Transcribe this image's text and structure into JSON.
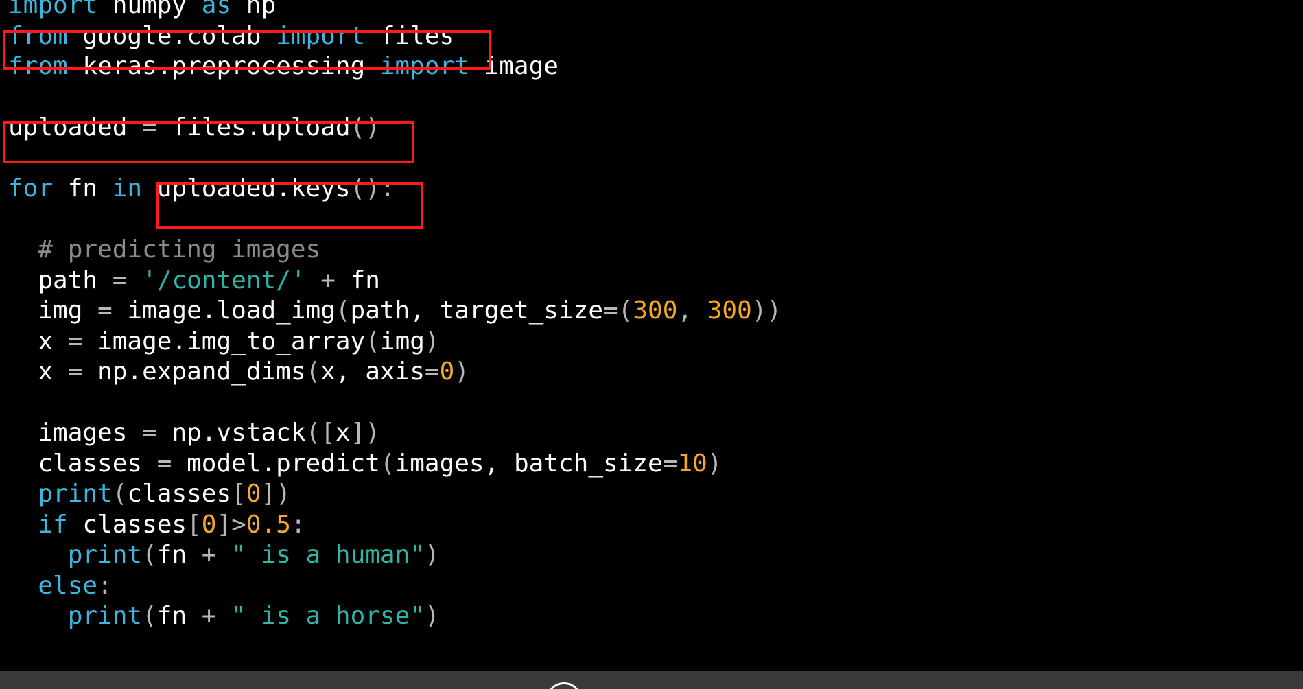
{
  "code": {
    "lines": [
      [
        {
          "t": "import",
          "c": "kw"
        },
        {
          "t": " numpy ",
          "c": ""
        },
        {
          "t": "as",
          "c": "kw"
        },
        {
          "t": " np",
          "c": ""
        }
      ],
      [
        {
          "t": "from",
          "c": "kw"
        },
        {
          "t": " google.colab ",
          "c": ""
        },
        {
          "t": "import",
          "c": "kw"
        },
        {
          "t": " files",
          "c": ""
        }
      ],
      [
        {
          "t": "from",
          "c": "kw"
        },
        {
          "t": " keras.preprocessing ",
          "c": ""
        },
        {
          "t": "import",
          "c": "kw"
        },
        {
          "t": " image",
          "c": ""
        }
      ],
      [],
      [
        {
          "t": "uploaded ",
          "c": ""
        },
        {
          "t": "=",
          "c": "op"
        },
        {
          "t": " files.upload",
          "c": ""
        },
        {
          "t": "()",
          "c": "op"
        }
      ],
      [],
      [
        {
          "t": "for",
          "c": "kw"
        },
        {
          "t": " fn ",
          "c": ""
        },
        {
          "t": "in",
          "c": "kw"
        },
        {
          "t": " uploaded.keys",
          "c": ""
        },
        {
          "t": "():",
          "c": "op"
        }
      ],
      [],
      [
        {
          "t": "  ",
          "c": ""
        },
        {
          "t": "# predicting images",
          "c": "cmt"
        }
      ],
      [
        {
          "t": "  path ",
          "c": ""
        },
        {
          "t": "=",
          "c": "op"
        },
        {
          "t": " ",
          "c": ""
        },
        {
          "t": "'/content/'",
          "c": "str"
        },
        {
          "t": " ",
          "c": ""
        },
        {
          "t": "+",
          "c": "op"
        },
        {
          "t": " fn",
          "c": ""
        }
      ],
      [
        {
          "t": "  img ",
          "c": ""
        },
        {
          "t": "=",
          "c": "op"
        },
        {
          "t": " image.load_img",
          "c": ""
        },
        {
          "t": "(",
          "c": "op"
        },
        {
          "t": "path, target_size",
          "c": ""
        },
        {
          "t": "=(",
          "c": "op"
        },
        {
          "t": "300",
          "c": "num"
        },
        {
          "t": ", ",
          "c": "op"
        },
        {
          "t": "300",
          "c": "num"
        },
        {
          "t": "))",
          "c": "op"
        }
      ],
      [
        {
          "t": "  x ",
          "c": ""
        },
        {
          "t": "=",
          "c": "op"
        },
        {
          "t": " image.img_to_array",
          "c": ""
        },
        {
          "t": "(",
          "c": "op"
        },
        {
          "t": "img",
          "c": ""
        },
        {
          "t": ")",
          "c": "op"
        }
      ],
      [
        {
          "t": "  x ",
          "c": ""
        },
        {
          "t": "=",
          "c": "op"
        },
        {
          "t": " np.expand_dims",
          "c": ""
        },
        {
          "t": "(",
          "c": "op"
        },
        {
          "t": "x, axis",
          "c": ""
        },
        {
          "t": "=",
          "c": "op"
        },
        {
          "t": "0",
          "c": "num"
        },
        {
          "t": ")",
          "c": "op"
        }
      ],
      [],
      [
        {
          "t": "  images ",
          "c": ""
        },
        {
          "t": "=",
          "c": "op"
        },
        {
          "t": " np.vstack",
          "c": ""
        },
        {
          "t": "([",
          "c": "op"
        },
        {
          "t": "x",
          "c": ""
        },
        {
          "t": "])",
          "c": "op"
        }
      ],
      [
        {
          "t": "  classes ",
          "c": ""
        },
        {
          "t": "=",
          "c": "op"
        },
        {
          "t": " model.predict",
          "c": ""
        },
        {
          "t": "(",
          "c": "op"
        },
        {
          "t": "images, batch_size",
          "c": ""
        },
        {
          "t": "=",
          "c": "op"
        },
        {
          "t": "10",
          "c": "num"
        },
        {
          "t": ")",
          "c": "op"
        }
      ],
      [
        {
          "t": "  ",
          "c": ""
        },
        {
          "t": "print",
          "c": "kw"
        },
        {
          "t": "(",
          "c": "op"
        },
        {
          "t": "classes",
          "c": ""
        },
        {
          "t": "[",
          "c": "op"
        },
        {
          "t": "0",
          "c": "num"
        },
        {
          "t": "])",
          "c": "op"
        }
      ],
      [
        {
          "t": "  ",
          "c": ""
        },
        {
          "t": "if",
          "c": "kw"
        },
        {
          "t": " classes",
          "c": ""
        },
        {
          "t": "[",
          "c": "op"
        },
        {
          "t": "0",
          "c": "num"
        },
        {
          "t": "]>",
          "c": "op"
        },
        {
          "t": "0.5",
          "c": "num"
        },
        {
          "t": ":",
          "c": "op"
        }
      ],
      [
        {
          "t": "    ",
          "c": ""
        },
        {
          "t": "print",
          "c": "kw"
        },
        {
          "t": "(",
          "c": "op"
        },
        {
          "t": "fn ",
          "c": ""
        },
        {
          "t": "+",
          "c": "op"
        },
        {
          "t": " ",
          "c": ""
        },
        {
          "t": "\" is a human\"",
          "c": "str"
        },
        {
          "t": ")",
          "c": "op"
        }
      ],
      [
        {
          "t": "  ",
          "c": ""
        },
        {
          "t": "else",
          "c": "kw"
        },
        {
          "t": ":",
          "c": "op"
        }
      ],
      [
        {
          "t": "    ",
          "c": ""
        },
        {
          "t": "print",
          "c": "kw"
        },
        {
          "t": "(",
          "c": "op"
        },
        {
          "t": "fn ",
          "c": ""
        },
        {
          "t": "+",
          "c": "op"
        },
        {
          "t": " ",
          "c": ""
        },
        {
          "t": "\" is a horse\"",
          "c": "str"
        },
        {
          "t": ")",
          "c": "op"
        }
      ]
    ]
  },
  "colors": {
    "background": "#000000",
    "keyword": "#3ab7e0",
    "comment": "#8a8a8a",
    "string": "#2fb5a8",
    "number": "#f4a823",
    "highlight_box": "#ff1a1a"
  },
  "bottom_bar": {
    "icon": "circle-logo-icon"
  }
}
